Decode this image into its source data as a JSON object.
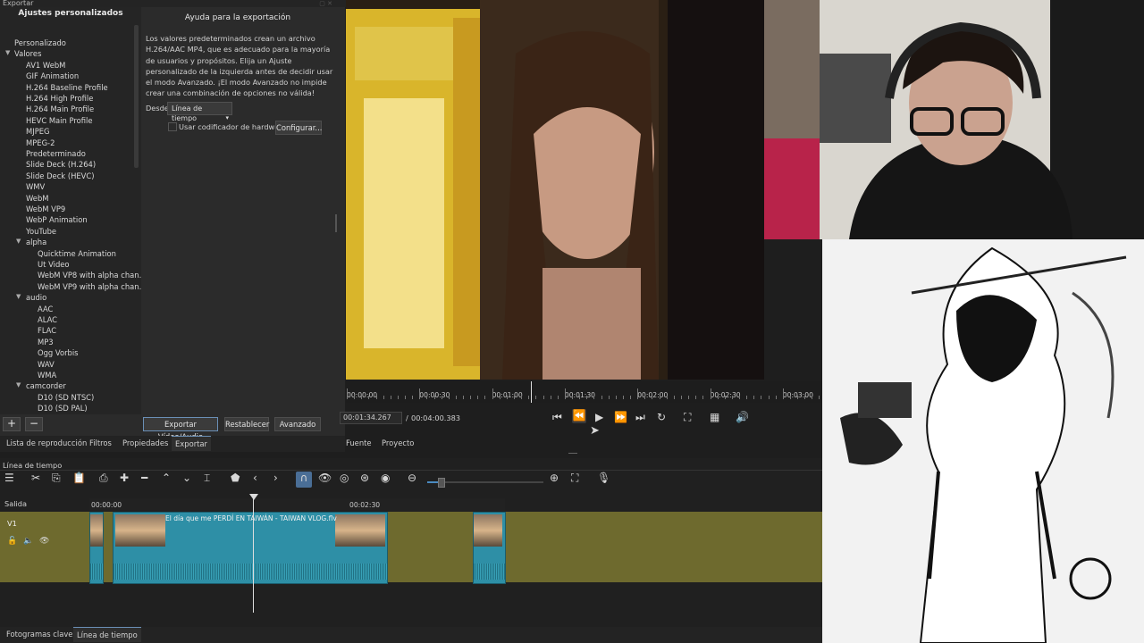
{
  "export": {
    "window_title": "Exportar",
    "presets_title": "Ajustes personalizados",
    "tree": [
      {
        "label": "Personalizado",
        "level": 0,
        "arrow": ""
      },
      {
        "label": "Valores",
        "level": 0,
        "arrow": "▼"
      },
      {
        "label": "AV1 WebM",
        "level": 1,
        "arrow": ""
      },
      {
        "label": "GIF Animation",
        "level": 1,
        "arrow": ""
      },
      {
        "label": "H.264 Baseline Profile",
        "level": 1,
        "arrow": ""
      },
      {
        "label": "H.264 High Profile",
        "level": 1,
        "arrow": ""
      },
      {
        "label": "H.264 Main Profile",
        "level": 1,
        "arrow": ""
      },
      {
        "label": "HEVC Main Profile",
        "level": 1,
        "arrow": ""
      },
      {
        "label": "MJPEG",
        "level": 1,
        "arrow": ""
      },
      {
        "label": "MPEG-2",
        "level": 1,
        "arrow": ""
      },
      {
        "label": "Predeterminado",
        "level": 1,
        "arrow": ""
      },
      {
        "label": "Slide Deck (H.264)",
        "level": 1,
        "arrow": ""
      },
      {
        "label": "Slide Deck (HEVC)",
        "level": 1,
        "arrow": ""
      },
      {
        "label": "WMV",
        "level": 1,
        "arrow": ""
      },
      {
        "label": "WebM",
        "level": 1,
        "arrow": ""
      },
      {
        "label": "WebM VP9",
        "level": 1,
        "arrow": ""
      },
      {
        "label": "WebP Animation",
        "level": 1,
        "arrow": ""
      },
      {
        "label": "YouTube",
        "level": 1,
        "arrow": ""
      },
      {
        "label": "alpha",
        "level": 1,
        "arrow": "▼"
      },
      {
        "label": "Quicktime Animation",
        "level": 2,
        "arrow": ""
      },
      {
        "label": "Ut Video",
        "level": 2,
        "arrow": ""
      },
      {
        "label": "WebM VP8 with alpha chan...",
        "level": 2,
        "arrow": ""
      },
      {
        "label": "WebM VP9 with alpha chan...",
        "level": 2,
        "arrow": ""
      },
      {
        "label": "audio",
        "level": 1,
        "arrow": "▼"
      },
      {
        "label": "AAC",
        "level": 2,
        "arrow": ""
      },
      {
        "label": "ALAC",
        "level": 2,
        "arrow": ""
      },
      {
        "label": "FLAC",
        "level": 2,
        "arrow": ""
      },
      {
        "label": "MP3",
        "level": 2,
        "arrow": ""
      },
      {
        "label": "Ogg Vorbis",
        "level": 2,
        "arrow": ""
      },
      {
        "label": "WAV",
        "level": 2,
        "arrow": ""
      },
      {
        "label": "WMA",
        "level": 2,
        "arrow": ""
      },
      {
        "label": "camcorder",
        "level": 1,
        "arrow": "▼"
      },
      {
        "label": "D10 (SD NTSC)",
        "level": 2,
        "arrow": ""
      },
      {
        "label": "D10 (SD PAL)",
        "level": 2,
        "arrow": ""
      }
    ],
    "help_title": "Ayuda para la exportación",
    "help_text": "Los valores predeterminados crean un archivo H.264/AAC MP4, que es adecuado para la mayoría de usuarios y propósitos. Elija un Ajuste personalizado de la izquierda antes de decidir usar el modo Avanzado. ¡El modo Avanzado no impide crear una combinación de opciones no válida!",
    "from_label": "Desde",
    "from_value": "Línea de tiempo",
    "hw_encoder_label": "Usar codificador de hardware",
    "configure_label": "Configurar...",
    "export_button": "Exportar Vídeo/Audio",
    "reset_button": "Restablecer",
    "advanced_button": "Avanzado",
    "add_label": "+",
    "remove_label": "−"
  },
  "bottom_tabs": [
    "Lista de reproducción",
    "Filtros",
    "Propiedades",
    "Exportar"
  ],
  "player": {
    "ruler_labels": [
      "00:00:00",
      "00:00:30",
      "00:01:00",
      "00:01:30",
      "00:02:00",
      "00:02:30",
      "00:03:00"
    ],
    "current_time": "00:01:34.267",
    "separator": "/",
    "total_time": "00:04:00.383",
    "tabs": [
      "Fuente",
      "Proyecto"
    ],
    "playhead_fraction": 0.39
  },
  "timeline": {
    "title": "Línea de tiempo",
    "output_label": "Salida",
    "track_label": "V1",
    "ruler_labels": [
      "00:00:00",
      "00:02:30"
    ],
    "clip_title": "El día que me PERDÍ EN TAIWÁN - TAIWAN VLOG.flv"
  },
  "footer_tabs": [
    "Fotogramas clave",
    "Línea de tiempo"
  ],
  "colors": {
    "accent": "#6a8fb6",
    "track": "#6e6a2e",
    "clip": "#2e8fa6"
  }
}
